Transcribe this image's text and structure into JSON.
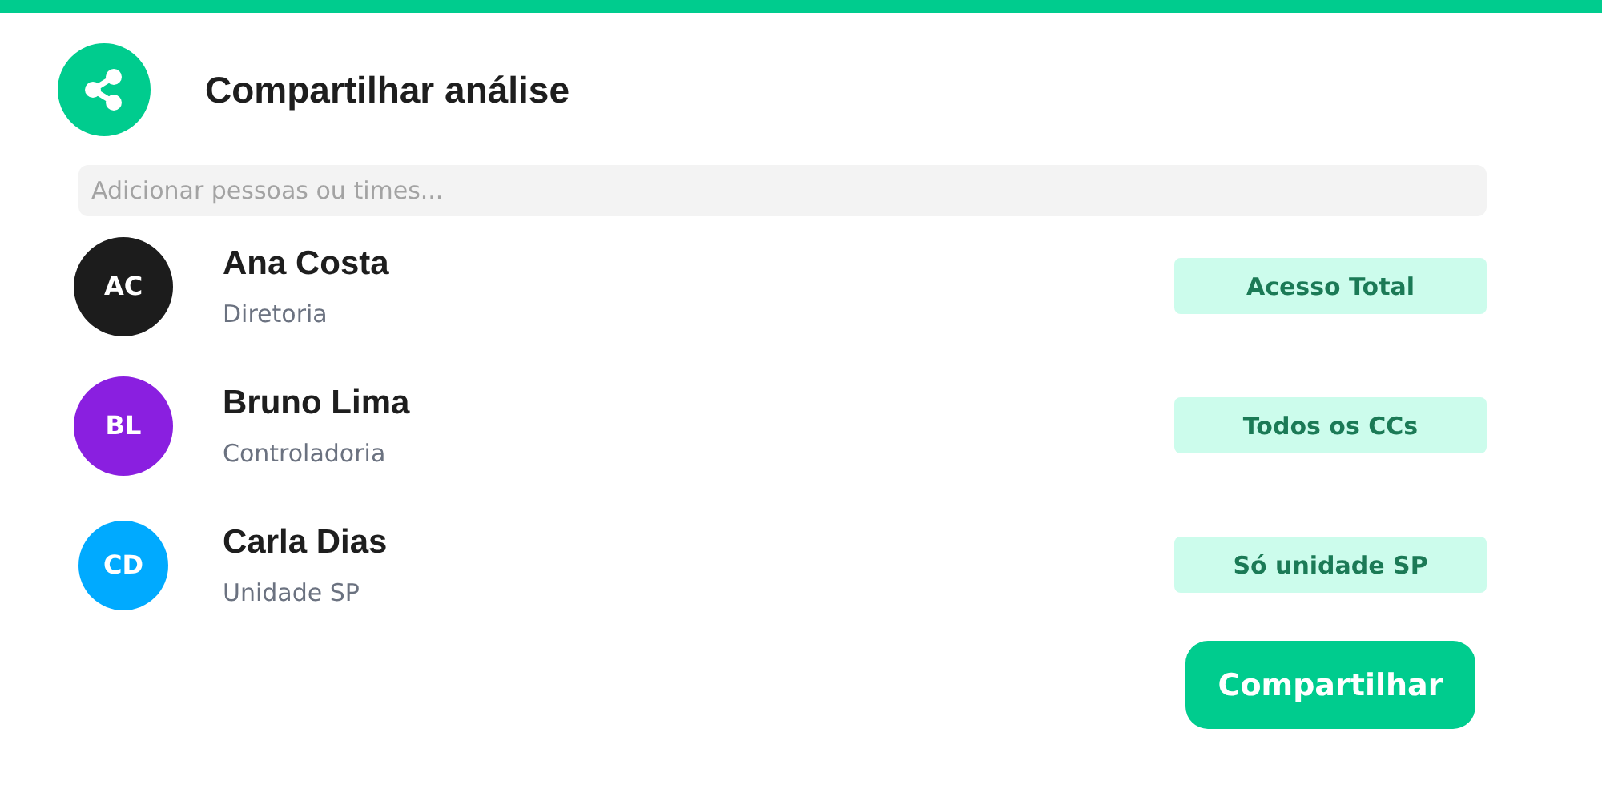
{
  "header": {
    "title": "Compartilhar análise"
  },
  "search": {
    "placeholder": "Adicionar pessoas ou times..."
  },
  "people": [
    {
      "initials": "AC",
      "name": "Ana Costa",
      "role": "Diretoria",
      "access": "Acesso Total",
      "color": "#1c1c1c"
    },
    {
      "initials": "BL",
      "name": "Bruno Lima",
      "role": "Controladoria",
      "access": "Todos os CCs",
      "color": "#8a1fe0"
    },
    {
      "initials": "CD",
      "name": "Carla Dias",
      "role": "Unidade SP",
      "access": "Só unidade SP",
      "color": "#00aaff"
    }
  ],
  "share_button": "Compartilhar"
}
